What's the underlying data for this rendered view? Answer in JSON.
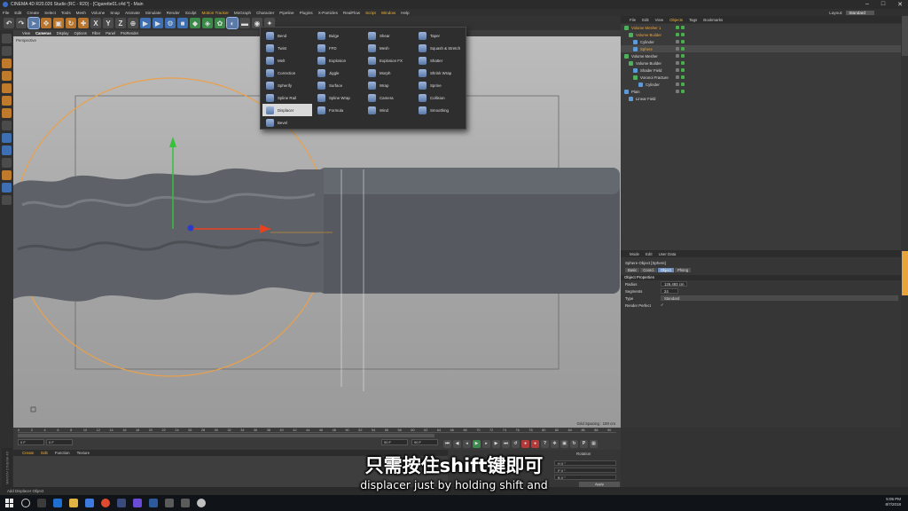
{
  "window": {
    "title": "CINEMA 4D R20.026 Studio (RC - R20) - [Cigarette01.c4d *] - Main"
  },
  "menubar": {
    "items": [
      "File",
      "Edit",
      "Create",
      "Select",
      "Tools",
      "Mesh",
      "Volume",
      "Snap",
      "Animate",
      "Simulate",
      "Render",
      "Sculpt",
      "Motion Tracker",
      "MoGraph",
      "Character",
      "Pipeline",
      "Plugins",
      "X-Particles",
      "RealFlow",
      "Script",
      "Window",
      "Help"
    ],
    "layout_label": "Layout:",
    "layout_value": "Standard"
  },
  "viewport": {
    "menu": [
      "View",
      "Cameras",
      "Display",
      "Options",
      "Filter",
      "Panel",
      "ProRender"
    ],
    "label": "Perspective",
    "unit_spacing": "Grid Spacing : 100 cm"
  },
  "deformer_menu": {
    "columns": [
      [
        "Bend",
        "Twist",
        "Melt",
        "Correction",
        "Spherify",
        "Spline Rail",
        "Displacer",
        "Bevel"
      ],
      [
        "Bulge",
        "FFD",
        "Explosion",
        "Jiggle",
        "Surface",
        "Spline Wrap",
        "Formula"
      ],
      [
        "Shear",
        "Mesh",
        "Explosion FX",
        "Morph",
        "Wrap",
        "Camera",
        "Wind"
      ],
      [
        "Taper",
        "Squash & Stretch",
        "Shatter",
        "Shrink Wrap",
        "Sprine",
        "Collision",
        "Smoothing"
      ]
    ],
    "selected": "Displacer"
  },
  "object_manager": {
    "tabs": [
      "File",
      "Edit",
      "View",
      "Objects",
      "Tags",
      "Bookmarks"
    ],
    "active_tab": "Objects",
    "rows": [
      {
        "name": "Volume Mesher 1",
        "indent": 0,
        "highlight": true
      },
      {
        "name": "Volume Builder",
        "indent": 1,
        "highlight": true
      },
      {
        "name": "Cylinder",
        "indent": 2,
        "highlight": false
      },
      {
        "name": "Sphere",
        "indent": 2,
        "highlight": true
      },
      {
        "name": "Volume Mesher",
        "indent": 0,
        "highlight": false
      },
      {
        "name": "Volume Builder",
        "indent": 1,
        "highlight": false
      },
      {
        "name": "Shader Field",
        "indent": 2,
        "highlight": false
      },
      {
        "name": "Voronoi Fracture",
        "indent": 2,
        "highlight": false
      },
      {
        "name": "Cylinder",
        "indent": 3,
        "highlight": false
      },
      {
        "name": "Plain",
        "indent": 0,
        "highlight": false
      },
      {
        "name": "Linear Field",
        "indent": 1,
        "highlight": false
      }
    ]
  },
  "attribute_manager": {
    "tabs": [
      "Mode",
      "Edit",
      "User Data"
    ],
    "object_title": "Sphere Object [Sphere]",
    "subtabs": [
      "Basic",
      "Coord.",
      "Object",
      "Phong"
    ],
    "active_subtab": "Object",
    "section": "Object Properties",
    "props": [
      {
        "label": "Radius",
        "value": "126.493 cm"
      },
      {
        "label": "Segments",
        "value": "24"
      },
      {
        "label": "Type",
        "value": "Standard"
      },
      {
        "label": "Render Perfect",
        "value": "✓"
      }
    ]
  },
  "timeline": {
    "ticks": [
      "0",
      "2",
      "4",
      "6",
      "8",
      "10",
      "12",
      "14",
      "16",
      "18",
      "20",
      "22",
      "24",
      "26",
      "28",
      "30",
      "32",
      "34",
      "36",
      "38",
      "40",
      "42",
      "44",
      "46",
      "48",
      "50",
      "52",
      "54",
      "56",
      "58",
      "60",
      "62",
      "64",
      "66",
      "68",
      "70",
      "72",
      "74",
      "76",
      "78",
      "80",
      "82",
      "84",
      "86",
      "88",
      "90"
    ],
    "start_field": "0 F",
    "start_field_2": "0 F",
    "end_field": "90 F",
    "end_field_2": "90 F"
  },
  "material_bar": {
    "items": [
      "Create",
      "Edit",
      "Function",
      "Texture"
    ]
  },
  "coordinates": {
    "header": "Rotation",
    "rows": [
      "H  0 °",
      "P  0 °",
      "B  0 °"
    ],
    "apply": "Apply"
  },
  "status": {
    "text": "Add Displacer Object"
  },
  "logo_text": "MAXON CINEMA 4D",
  "taskbar": {
    "time": "5:05 PM",
    "date": "8/7/2018"
  },
  "subtitles": {
    "chinese": "只需按住shift键即可",
    "english": "displacer just by holding shift and"
  }
}
